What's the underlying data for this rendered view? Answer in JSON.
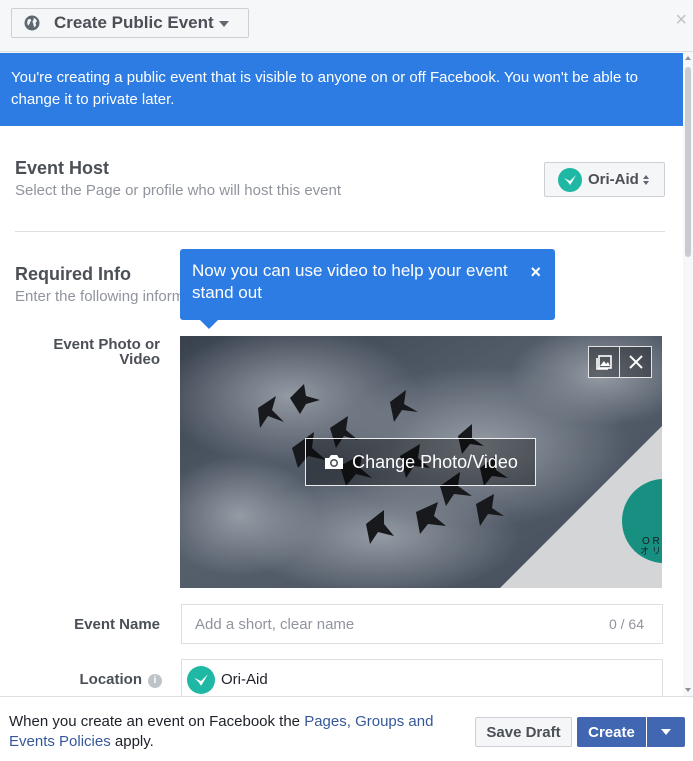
{
  "header": {
    "event_type_label": "Create Public Event",
    "close_symbol": "×"
  },
  "banner": {
    "text": "You're creating a public event that is visible to anyone on or off Facebook. You won't be able to change it to private later."
  },
  "event_host": {
    "title": "Event Host",
    "subtitle": "Select the Page or profile who will host this event",
    "selected_host": "Ori-Aid"
  },
  "required_info": {
    "title": "Required Info",
    "subtitle": "Enter the following inform"
  },
  "tooltip": {
    "text": "Now you can use video to help your event stand out",
    "close_symbol": "×"
  },
  "photo": {
    "label": "Event Photo or Video",
    "change_button": "Change Photo/Video",
    "watermark_text_1": "O R",
    "watermark_text_2": "オ リ"
  },
  "event_name": {
    "label": "Event Name",
    "placeholder": "Add a short, clear name",
    "counter": "0 / 64"
  },
  "location": {
    "label": "Location",
    "info_symbol": "i",
    "value": "Ori-Aid"
  },
  "footer": {
    "policy_prefix": "When you create an event on Facebook the ",
    "policy_link": "Pages, Groups and Events Policies",
    "policy_suffix": " apply.",
    "save_draft": "Save Draft",
    "create": "Create"
  },
  "colors": {
    "accent_blue": "#2d7ce3",
    "button_blue": "#4267b2",
    "link_blue": "#365899",
    "brand_teal": "#1fb8a4"
  }
}
